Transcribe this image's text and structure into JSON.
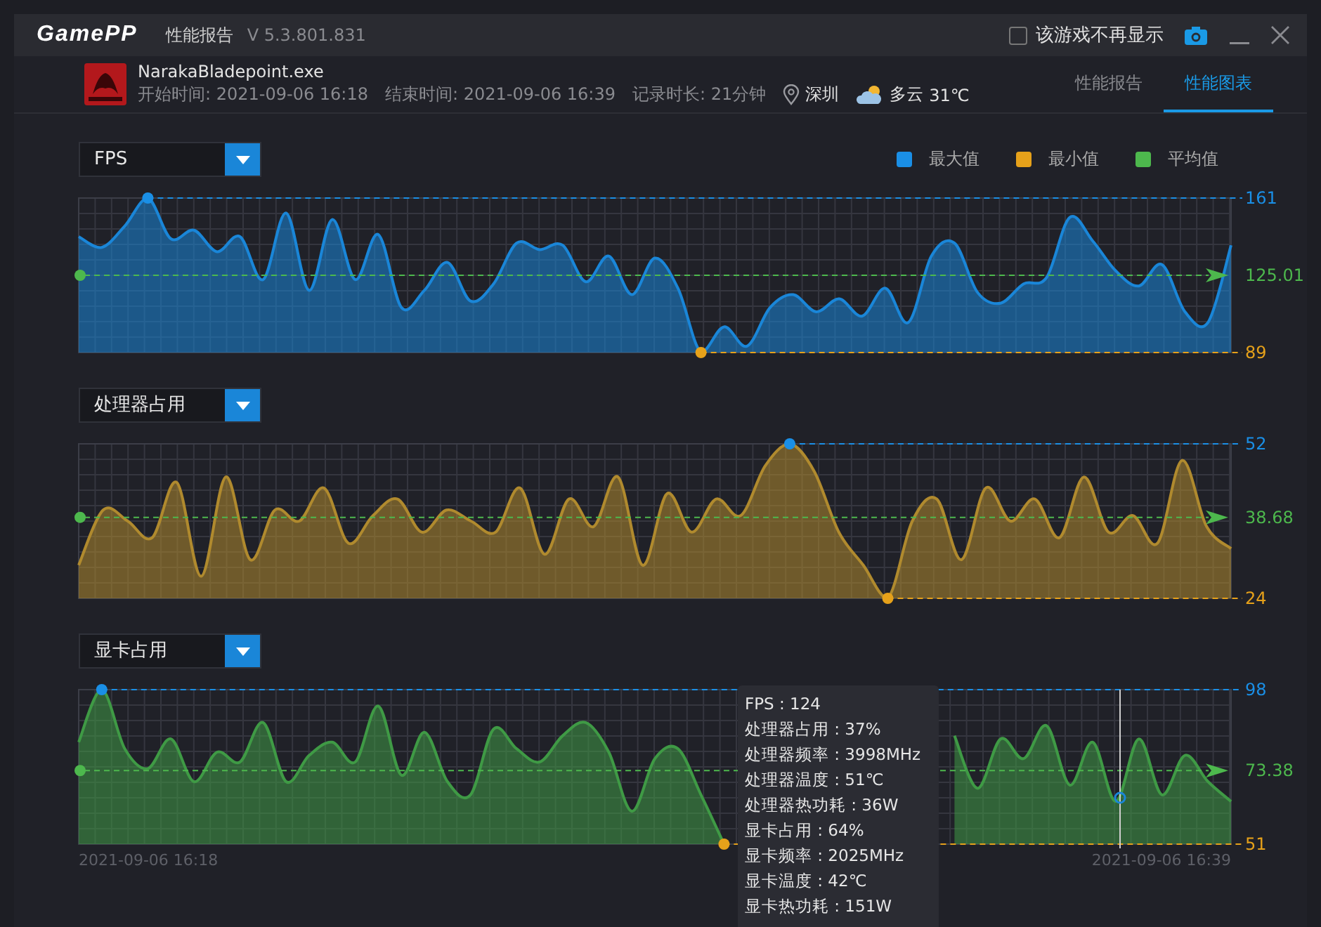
{
  "window": {
    "logo": "GamePP",
    "title": "性能报告",
    "version": "V 5.3.801.831",
    "hide_game": {
      "label": "该游戏不再显示",
      "checked": false
    }
  },
  "session": {
    "exe": "NarakaBladepoint.exe",
    "start": "开始时间: 2021-09-06 16:18",
    "end": "结束时间: 2021-09-06 16:39",
    "duration": "记录时长: 21分钟",
    "location": "深圳",
    "weather": "多云",
    "temperature": "31℃"
  },
  "tabs": [
    {
      "label": "性能报告",
      "selected": false
    },
    {
      "label": "性能图表",
      "selected": true
    }
  ],
  "legend": [
    {
      "label": "最大值",
      "color": "#1a8fe6"
    },
    {
      "label": "最小值",
      "color": "#e6a11a"
    },
    {
      "label": "平均值",
      "color": "#4db84d"
    }
  ],
  "panels": [
    {
      "chart_data": {
        "type": "area",
        "grid": true,
        "ylim": [
          89,
          161
        ],
        "yticks": [
          {
            "value": 89,
            "label": "89"
          },
          {
            "value": 161,
            "label": "161"
          }
        ],
        "ref_lines": [
          {
            "axis": "y",
            "value": 125.01,
            "label": "125.01",
            "color": "#4db84d"
          }
        ],
        "series": [
          {
            "name": "FPS",
            "color": "#1a86d8",
            "values": [
              143,
              138,
              148,
              161,
              142,
              146,
              136,
              143,
              123,
              154,
              118,
              151,
              123,
              144,
              110,
              118,
              131,
              113,
              121,
              140,
              137,
              139,
              122,
              134,
              116,
              133,
              119,
              89,
              101,
              92,
              110,
              116,
              108,
              114,
              106,
              119,
              103,
              134,
              140,
              117,
              112,
              121,
              124,
              152,
              141,
              127,
              120,
              130,
              108,
              103,
              139
            ]
          }
        ]
      }
    },
    {
      "chart_data": {
        "type": "area",
        "grid": true,
        "ylim": [
          24,
          52
        ],
        "yticks": [
          {
            "value": 24,
            "label": "24"
          },
          {
            "value": 52,
            "label": "52"
          }
        ],
        "ref_lines": [
          {
            "axis": "y",
            "value": 38.68,
            "label": "38.68",
            "color": "#4db84d"
          }
        ],
        "series": [
          {
            "name": "处理器占用",
            "color": "#b08a2e",
            "values": [
              30,
              40,
              38,
              35,
              45,
              28,
              46,
              31,
              40,
              38,
              44,
              34,
              39,
              42,
              36,
              40,
              38,
              36,
              44,
              32,
              42,
              37,
              46,
              30,
              43,
              36,
              42,
              39,
              48,
              52,
              47,
              36,
              30,
              24,
              38,
              42,
              31,
              44,
              38,
              42,
              35,
              46,
              36,
              39,
              34,
              49,
              37,
              33
            ]
          }
        ]
      }
    },
    {
      "chart_data": {
        "type": "area",
        "grid": true,
        "ylim": [
          51,
          98
        ],
        "yticks": [
          {
            "value": 51,
            "label": "51"
          },
          {
            "value": 98,
            "label": "98"
          }
        ],
        "ref_lines": [
          {
            "axis": "y",
            "value": 73.38,
            "label": "73.38",
            "color": "#4db84d"
          }
        ],
        "series": [
          {
            "name": "显卡占用",
            "color": "#3f9a45",
            "values": [
              82,
              98,
              80,
              74,
              83,
              70,
              79,
              76,
              88,
              70,
              78,
              82,
              76,
              93,
              72,
              85,
              70,
              66,
              86,
              80,
              76,
              84,
              88,
              79,
              61,
              77,
              80,
              66,
              51,
              null,
              null,
              null,
              null,
              null,
              null,
              null,
              null,
              null,
              84,
              68,
              83,
              77,
              87,
              69,
              82,
              64,
              83,
              66,
              78,
              70,
              64
            ]
          }
        ]
      }
    }
  ],
  "x_axis": {
    "start": "2021-09-06 16:18",
    "end": "2021-09-06 16:39"
  },
  "tooltip": {
    "lines": [
      "FPS : 124",
      "处理器占用 : 37%",
      "处理器频率 : 3998MHz",
      "处理器温度 : 51℃",
      "处理器热功耗 : 36W",
      "显卡占用 : 64%",
      "显卡频率 : 2025MHz",
      "显卡温度 : 42℃",
      "显卡热功耗 : 151W"
    ]
  }
}
